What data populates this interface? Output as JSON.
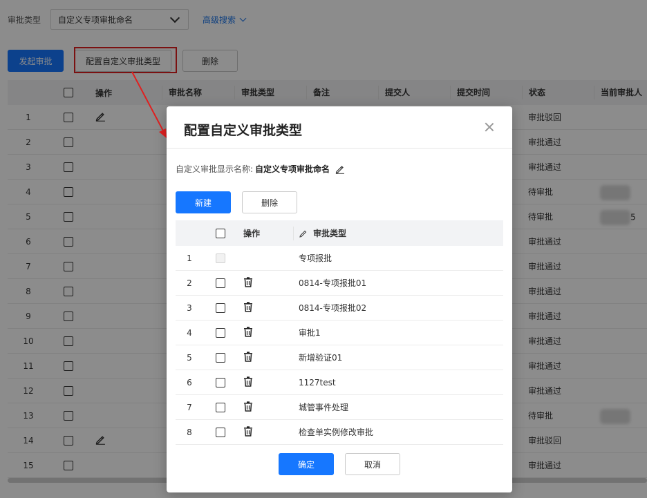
{
  "filter": {
    "label": "审批类型",
    "select_value": "自定义专项审批命名",
    "advanced_search": "高级搜索"
  },
  "toolbar": {
    "start_label": "发起审批",
    "config_label": "配置自定义审批类型",
    "delete_label": "删除"
  },
  "main_table": {
    "columns": [
      "操作",
      "审批名称",
      "审批类型",
      "备注",
      "提交人",
      "提交时间",
      "状态",
      "当前审批人"
    ],
    "rows": [
      {
        "no": "1",
        "status": "审批驳回",
        "has_edit": true,
        "cur": ""
      },
      {
        "no": "2",
        "status": "审批通过",
        "has_edit": false,
        "cur": ""
      },
      {
        "no": "3",
        "status": "审批通过",
        "has_edit": false,
        "cur": ""
      },
      {
        "no": "4",
        "status": "待审批",
        "has_edit": false,
        "cur": "blur"
      },
      {
        "no": "5",
        "status": "待审批",
        "has_edit": false,
        "cur": "blur5"
      },
      {
        "no": "6",
        "status": "审批通过",
        "has_edit": false,
        "cur": ""
      },
      {
        "no": "7",
        "status": "审批通过",
        "has_edit": false,
        "cur": ""
      },
      {
        "no": "8",
        "status": "审批通过",
        "has_edit": false,
        "cur": ""
      },
      {
        "no": "9",
        "status": "审批通过",
        "has_edit": false,
        "cur": ""
      },
      {
        "no": "10",
        "status": "审批通过",
        "has_edit": false,
        "cur": ""
      },
      {
        "no": "11",
        "status": "审批通过",
        "has_edit": false,
        "cur": ""
      },
      {
        "no": "12",
        "status": "审批通过",
        "has_edit": false,
        "cur": ""
      },
      {
        "no": "13",
        "status": "待审批",
        "has_edit": false,
        "cur": "blur"
      },
      {
        "no": "14",
        "status": "审批驳回",
        "has_edit": true,
        "cur": ""
      },
      {
        "no": "15",
        "status": "审批通过",
        "has_edit": false,
        "cur": ""
      }
    ],
    "suffix_5": "5"
  },
  "modal": {
    "title": "配置自定义审批类型",
    "display_label": "自定义审批显示名称:",
    "display_value": "自定义专项审批命名",
    "new_label": "新建",
    "delete_label": "删除",
    "col_op": "操作",
    "col_type": "审批类型",
    "rows": [
      {
        "no": "1",
        "type": "专项报批",
        "disabled": true
      },
      {
        "no": "2",
        "type": "0814-专项报批01",
        "disabled": false
      },
      {
        "no": "3",
        "type": "0814-专项报批02",
        "disabled": false
      },
      {
        "no": "4",
        "type": "审批1",
        "disabled": false
      },
      {
        "no": "5",
        "type": "新增验证01",
        "disabled": false
      },
      {
        "no": "6",
        "type": "1127test",
        "disabled": false
      },
      {
        "no": "7",
        "type": "城管事件处理",
        "disabled": false
      },
      {
        "no": "8",
        "type": "检查单实例修改审批",
        "disabled": false
      }
    ],
    "ok_label": "确定",
    "cancel_label": "取消"
  },
  "colors": {
    "primary": "#1677ff",
    "highlight": "#e02020"
  }
}
